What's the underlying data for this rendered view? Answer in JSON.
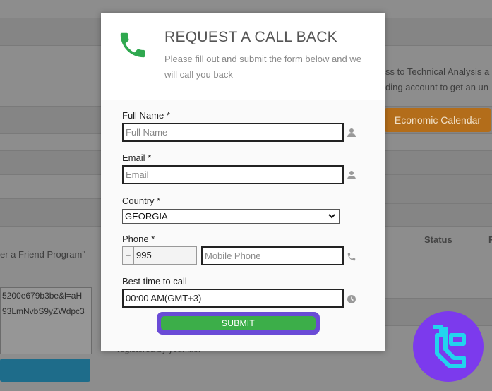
{
  "background": {
    "text_right_1": "ss to Technical Analysis a",
    "text_right_2": "ding account to get an un",
    "economic_calendar": "Economic Calendar",
    "status_header": "Status",
    "status_header_cut": "F",
    "friend_program": "er a Friend Program\"",
    "textarea_lines": [
      "5200e679b3be&l=aH",
      "93LmNvbS9yZWdpc3"
    ],
    "bottom_cut_text": "registered by your link"
  },
  "modal": {
    "title": "REQUEST A CALL BACK",
    "subtitle": "Please fill out and submit the form below and we will call you back",
    "full_name": {
      "label": "Full Name *",
      "placeholder": "Full Name",
      "value": ""
    },
    "email": {
      "label": "Email *",
      "placeholder": "Email",
      "value": ""
    },
    "country": {
      "label": "Country *",
      "value": "GEORGIA"
    },
    "phone": {
      "label": "Phone *",
      "prefix": "+",
      "code": "995",
      "placeholder": "Mobile Phone",
      "value": ""
    },
    "best_time": {
      "label": "Best time to call",
      "value": "00:00 AM(GMT+3)"
    },
    "submit_label": "SUBMIT"
  },
  "colors": {
    "accent_green": "#3cae49",
    "highlight_purple": "#6a4bd6",
    "phone_icon_green": "#2fa84f",
    "logo_bg": "#7c3aed",
    "logo_stroke": "#22d3ee"
  },
  "icons": {
    "phone": "phone-icon",
    "user": "user-icon",
    "handset": "handset-icon",
    "clock": "clock-icon",
    "dropdown": "chevron-down-icon",
    "logo": "brand-logo-icon"
  }
}
